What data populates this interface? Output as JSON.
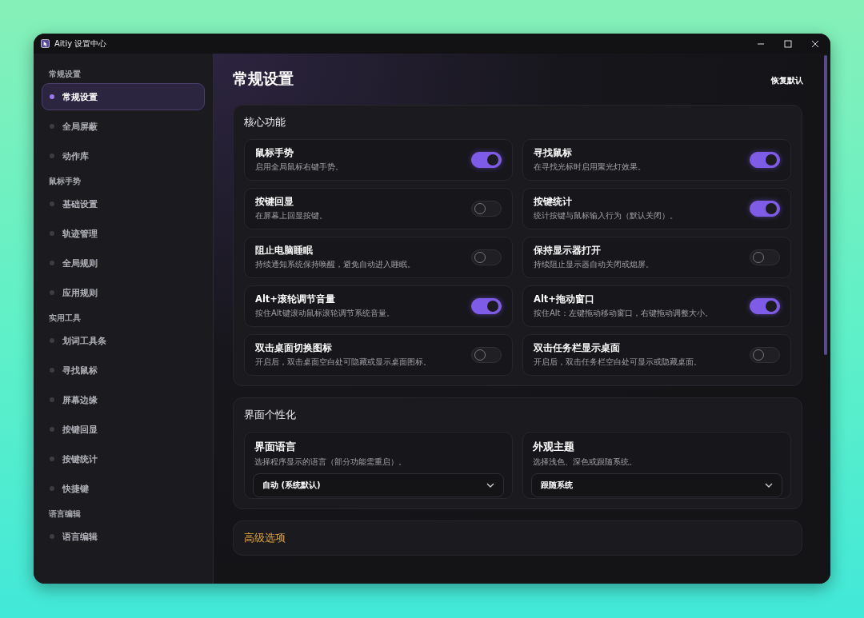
{
  "window": {
    "title": "Aitiy 设置中心"
  },
  "sidebar": {
    "groups": [
      {
        "title": "常规设置",
        "items": [
          {
            "label": "常规设置",
            "selected": true
          },
          {
            "label": "全局屏蔽",
            "selected": false
          },
          {
            "label": "动作库",
            "selected": false
          }
        ]
      },
      {
        "title": "鼠标手势",
        "items": [
          {
            "label": "基础设置",
            "selected": false
          },
          {
            "label": "轨迹管理",
            "selected": false
          },
          {
            "label": "全局规则",
            "selected": false
          },
          {
            "label": "应用规则",
            "selected": false
          }
        ]
      },
      {
        "title": "实用工具",
        "items": [
          {
            "label": "划词工具条",
            "selected": false
          },
          {
            "label": "寻找鼠标",
            "selected": false
          },
          {
            "label": "屏幕边缘",
            "selected": false
          },
          {
            "label": "按键回显",
            "selected": false
          },
          {
            "label": "按键统计",
            "selected": false
          },
          {
            "label": "快捷键",
            "selected": false
          }
        ]
      },
      {
        "title": "语言编辑",
        "items": [
          {
            "label": "语言编辑",
            "selected": false
          }
        ]
      }
    ]
  },
  "page": {
    "title": "常规设置",
    "reset_button": "恢复默认"
  },
  "sections": [
    {
      "title": "核心功能",
      "kind": "toggles",
      "items": [
        {
          "title": "鼠标手势",
          "description": "启用全局鼠标右键手势。",
          "on": true
        },
        {
          "title": "寻找鼠标",
          "description": "在寻找光标时启用聚光灯效果。",
          "on": true
        },
        {
          "title": "按键回显",
          "description": "在屏幕上回显按键。",
          "on": false
        },
        {
          "title": "按键统计",
          "description": "统计按键与鼠标输入行为（默认关闭）。",
          "on": true
        },
        {
          "title": "阻止电脑睡眠",
          "description": "持续通知系统保持唤醒，避免自动进入睡眠。",
          "on": false
        },
        {
          "title": "保持显示器打开",
          "description": "持续阻止显示器自动关闭或熄屏。",
          "on": false
        },
        {
          "title": "Alt+滚轮调节音量",
          "description": "按住Alt键滚动鼠标滚轮调节系统音量。",
          "on": true
        },
        {
          "title": "Alt+拖动窗口",
          "description": "按住Alt：左键拖动移动窗口，右键拖动调整大小。",
          "on": true
        },
        {
          "title": "双击桌面切换图标",
          "description": "开启后，双击桌面空白处可隐藏或显示桌面图标。",
          "on": false
        },
        {
          "title": "双击任务栏显示桌面",
          "description": "开启后，双击任务栏空白处可显示或隐藏桌面。",
          "on": false
        }
      ]
    },
    {
      "title": "界面个性化",
      "kind": "selects",
      "items": [
        {
          "title": "界面语言",
          "description": "选择程序显示的语言（部分功能需重启）。",
          "value": "自动 (系统默认)"
        },
        {
          "title": "外观主题",
          "description": "选择浅色、深色或跟随系统。",
          "value": "跟随系统"
        }
      ]
    },
    {
      "title": "高级选项",
      "kind": "collapsed"
    }
  ]
}
